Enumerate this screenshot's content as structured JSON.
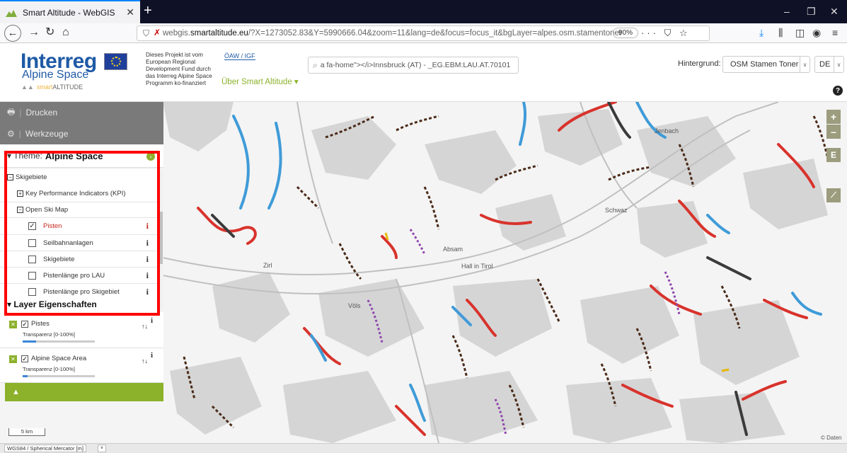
{
  "browser": {
    "tab_title": "Smart Altitude - WebGIS",
    "url_host_prefix": "webgis.",
    "url_host_main": "smartaltitude.eu",
    "url_rest": "/?X=1273052.83&Y=5990666.04&zoom=11&lang=de&focus=focus_it&bgLayer=alpes.osm.stamentoner",
    "zoom_level": "90%",
    "url_icons": "··· ⛉ ☆"
  },
  "header": {
    "logo_main": "Interreg",
    "logo_sub": "Alpine Space",
    "logo_smart_1": "smart",
    "logo_smart_2": "ALTITUDE",
    "project_text": "Dieses Projekt ist vom European Regional Development Fund durch das Interreg Alpine Space Programm ko-finanziert",
    "partner_logo": "ÖAW / IGF",
    "about_menu": "Über Smart Altitude ▾",
    "search_value": "a fa-home\"></i>Innsbruck (AT) - _EG.EBM:LAU.AT.70101",
    "background_label": "Hintergrund:",
    "background_value": "OSM Stamen Toner",
    "language_value": "DE"
  },
  "sidebar": {
    "print_label": "Drucken",
    "tools_label": "Werkzeuge",
    "theme_prefix": "▾ Theme:",
    "theme_name": "Alpine Space",
    "tree": {
      "group_label": "Skigebiete",
      "kpi_label": "Key Performance Indicators (KPI)",
      "open_ski_map_label": "Open Ski Map",
      "items": [
        {
          "label": "Pisten",
          "checked": true
        },
        {
          "label": "Seilbahnanlagen",
          "checked": false
        },
        {
          "label": "Skigebiete",
          "checked": false
        },
        {
          "label": "Pistenlänge pro LAU",
          "checked": false
        },
        {
          "label": "Pistenlänge pro Skigebiet",
          "checked": false
        }
      ]
    },
    "layer_props_title": "▾ Layer Eigenschaften",
    "layers": [
      {
        "name": "Pistes",
        "transparency_label": "Transparenz [0-100%]",
        "transparency": 0.15
      },
      {
        "name": "Alpine Space Area",
        "transparency_label": "Transparenz [0-100%]",
        "transparency": 0.03
      }
    ]
  },
  "map": {
    "places": {
      "zirl": "Zirl",
      "absam": "Absam",
      "hall": "Hall in Tirol",
      "vols": "Völs",
      "schwaz": "Schwaz",
      "jenbach": "Jenbach"
    },
    "scale": "5 km",
    "attribution": "© Daten"
  },
  "status": {
    "projection": "WGS84 / Spherical Mercator [m]"
  },
  "colors": {
    "accent_green": "#8cb12a",
    "brand_blue": "#1f5aa6",
    "piste_red": "#d8332c",
    "piste_blue": "#3f9bd8",
    "piste_black": "#3b3b3b",
    "lift_dark": "#4a2a18",
    "purple": "#8e44ad",
    "highlight_red": "#ff0000"
  }
}
